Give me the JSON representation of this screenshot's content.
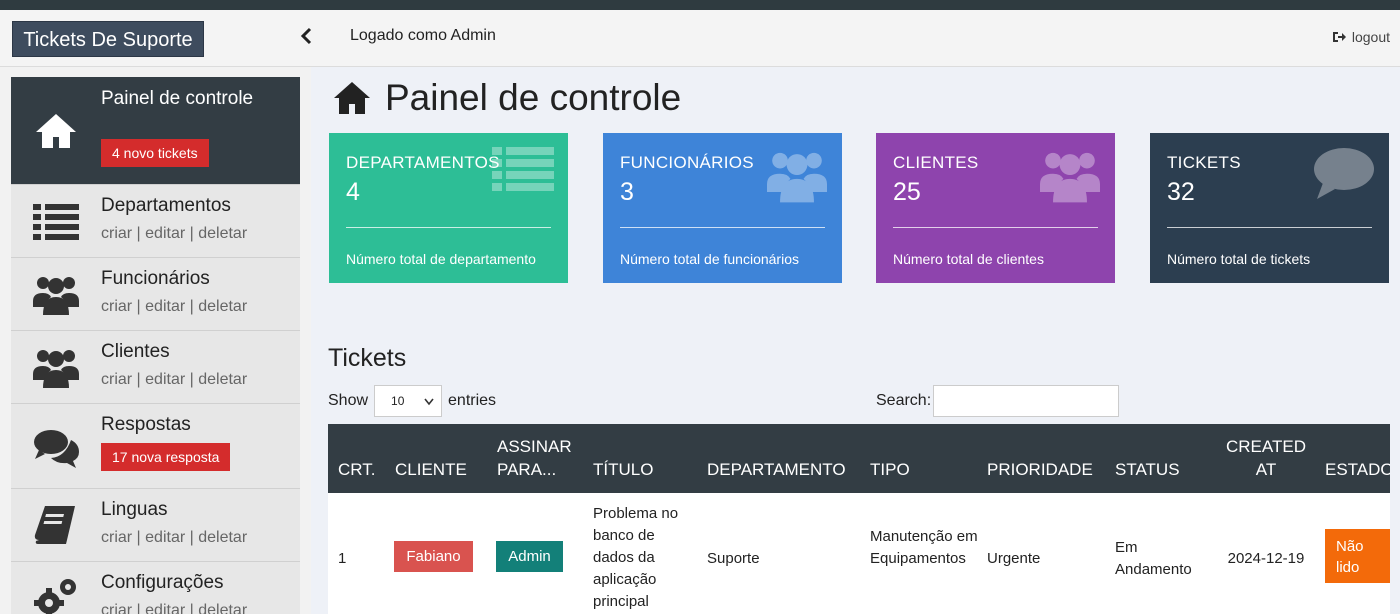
{
  "header": {
    "brand": "Tickets De Suporte",
    "logged_as": "Logado como Admin",
    "logout": "logout"
  },
  "sidebar": {
    "items": [
      {
        "title": "Painel de controle",
        "badge": "4 novo tickets"
      },
      {
        "title": "Departamentos",
        "sub": "criar | editar | deletar"
      },
      {
        "title": "Funcionários",
        "sub": "criar | editar | deletar"
      },
      {
        "title": "Clientes",
        "sub": "criar | editar | deletar"
      },
      {
        "title": "Respostas",
        "badge": "17 nova resposta"
      },
      {
        "title": "Linguas",
        "sub": "criar | editar | deletar"
      },
      {
        "title": "Configurações",
        "sub": "criar | editar | deletar"
      }
    ]
  },
  "main": {
    "title": "Painel de controle",
    "cards": [
      {
        "label": "DEPARTAMENTOS",
        "value": "4",
        "footer": "Número total de departamento",
        "color": "#2dbe96"
      },
      {
        "label": "FUNCIONÁRIOS",
        "value": "3",
        "footer": "Número total de funcionários",
        "color": "#3e84d8"
      },
      {
        "label": "CLIENTES",
        "value": "25",
        "footer": "Número total de clientes",
        "color": "#8e44ad"
      },
      {
        "label": "TICKETS",
        "value": "32",
        "footer": "Número total de tickets",
        "color": "#2c3e50"
      }
    ],
    "section_title": "Tickets",
    "show_label": "Show",
    "entries_value": "10",
    "entries_label": "entries",
    "search_label": "Search:",
    "table": {
      "headers": [
        "CRT.",
        "CLIENTE",
        "ASSINAR PARA...",
        "TÍTULO",
        "DEPARTAMENTO",
        "TIPO",
        "PRIORIDADE",
        "STATUS",
        "CREATED AT",
        "ESTADO"
      ],
      "row": {
        "crt": "1",
        "cliente": "Fabiano",
        "assinar": "Admin",
        "titulo": "Problema no banco de dados da aplicação principal",
        "departamento": "Suporte",
        "tipo": "Manutenção em Equipamentos",
        "prioridade": "Urgente",
        "status": "Em Andamento",
        "created": "2024-12-19",
        "estado": "Não lido"
      }
    }
  }
}
